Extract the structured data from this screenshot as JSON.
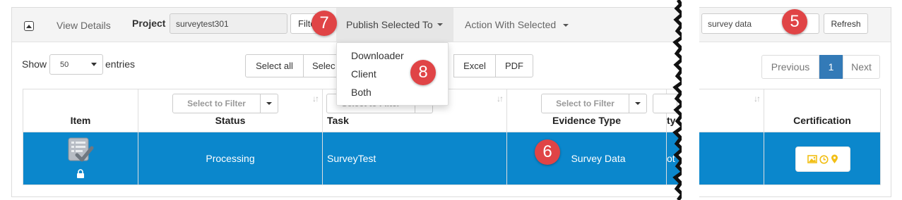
{
  "toolbar": {
    "view_details": "View Details",
    "project_label": "Project",
    "project_value": "surveytest301",
    "filter_button": "Filte",
    "publish_selected": "Publish Selected To",
    "action_with_selected": "Action With Selected",
    "search_value": "survey data",
    "refresh": "Refresh"
  },
  "publish_menu": {
    "items": [
      "Downloader",
      "Client",
      "Both"
    ]
  },
  "length_control": {
    "show_label": "Show",
    "entries_value": "50",
    "entries_label": "entries"
  },
  "export_buttons": {
    "select_all": "Select all",
    "select_partial": "Selec",
    "excel": "Excel",
    "pdf": "PDF"
  },
  "pagination": {
    "previous": "Previous",
    "current_page": "1",
    "next": "Next"
  },
  "table": {
    "filter_placeholder": "Select to Filter",
    "filter_placeholder_partial": "Select to Filter",
    "columns": [
      "Item",
      "Status",
      "Task",
      "Evidence Type",
      "ty",
      "Certification"
    ],
    "row": {
      "status": "Processing",
      "task": "SurveyTest",
      "evidence_type": "Survey Data",
      "partial_cell": "ot"
    }
  },
  "callouts": {
    "five": "5",
    "six": "6",
    "seven": "7",
    "eight": "8"
  },
  "colors": {
    "selected_row": "#0b87cc",
    "callout_red": "#e04446",
    "cert_icon_yellow": "#f2bf16",
    "active_page": "#337ab7"
  }
}
